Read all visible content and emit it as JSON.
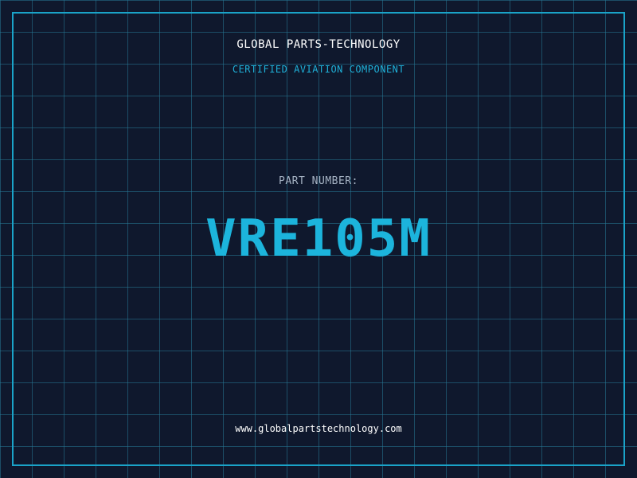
{
  "company_name": "GLOBAL PARTS-TECHNOLOGY",
  "tagline": "CERTIFIED AVIATION COMPONENT",
  "part_label": "PART NUMBER:",
  "part_number": "VRE105M",
  "website": "www.globalpartstechnology.com",
  "colors": {
    "background": "#0f182d",
    "grid": "#267896",
    "accent": "#1cb4dc",
    "text_primary": "#ffffff",
    "text_muted": "#a6b3c4"
  }
}
